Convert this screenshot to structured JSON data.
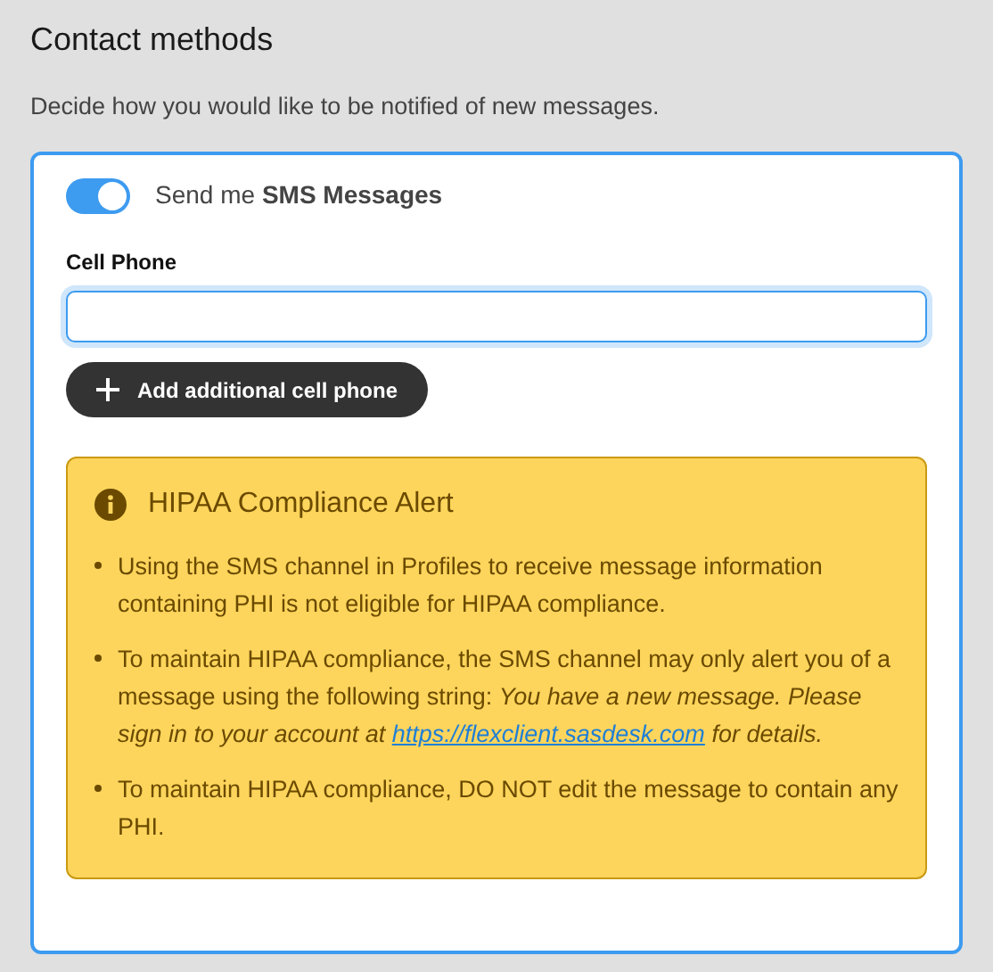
{
  "heading": "Contact methods",
  "description": "Decide how you would like to be notified of new messages.",
  "sms": {
    "on": true,
    "label": "Send me **SMS Messages**"
  },
  "cell_phone": {
    "label": "Cell Phone",
    "focused": true
  },
  "add_button": {
    "label": "Add additional cell phone"
  },
  "alert": {
    "title": "HIPAA Compliance Alert",
    "items": [
      {
        "text": "Using the SMS channel in Profiles to receive message information containing PHI is not eligible for HIPAA compliance."
      },
      {
        "text": "To maintain HIPAA compliance, the SMS channel may only alert you of a message using the following string: *You have a new message. Please sign in to your account at*",
        "link": "https://flexclient.sasdesk.com",
        "text_after": "*for details.*"
      },
      {
        "text": "To maintain HIPAA compliance, DO NOT edit the message to contain any PHI."
      }
    ]
  }
}
